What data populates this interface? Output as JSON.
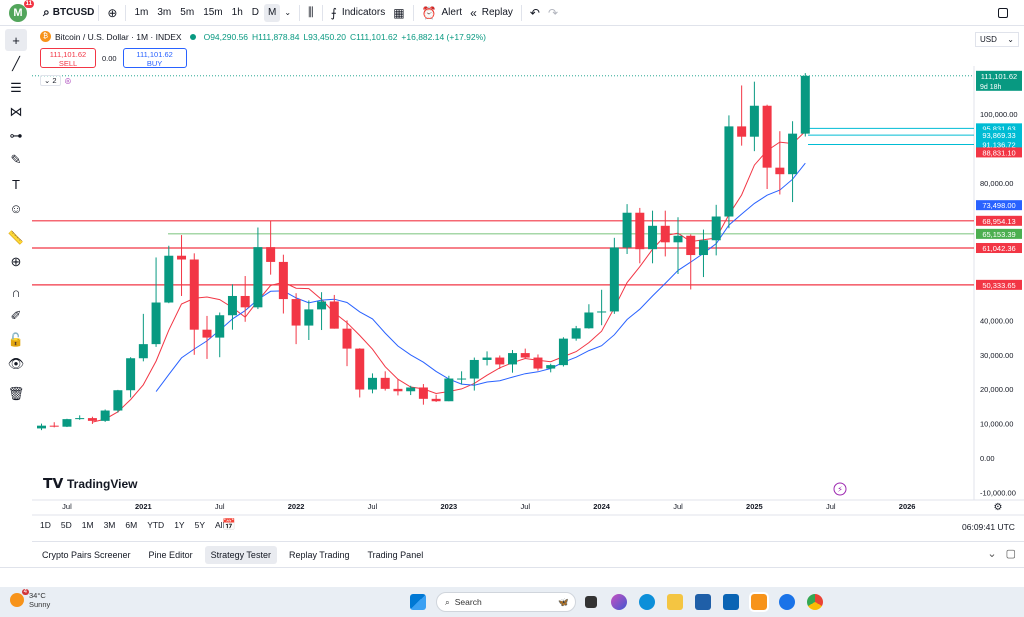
{
  "topbar": {
    "avatar_letter": "M",
    "notification_count": "11",
    "symbol": "BTCUSD",
    "timeframes": [
      "1m",
      "3m",
      "5m",
      "15m",
      "1h",
      "D",
      "M"
    ],
    "active_timeframe": "M",
    "indicators_label": "Indicators",
    "alert_label": "Alert",
    "replay_label": "Replay"
  },
  "legend": {
    "title": "Bitcoin / U.S. Dollar · 1M · INDEX",
    "open": "O94,290.56",
    "high": "H111,878.84",
    "low": "L93,450.20",
    "close": "C111,101.62",
    "change": "+16,882.14 (+17.92%)"
  },
  "trade": {
    "sell_price": "111,101.62",
    "sell_label": "SELL",
    "spread": "0.00",
    "buy_price": "111,101.62",
    "buy_label": "BUY"
  },
  "indicator_count": "2",
  "currency": "USD",
  "chart_data": {
    "type": "candlestick",
    "y_range": [
      -10000,
      125000
    ],
    "y_ticks": [
      "100,000.00",
      "80,000.00",
      "40,000.00",
      "30,000.00",
      "20,000.00",
      "10,000.00",
      "0.00",
      "-10,000.00"
    ],
    "x_ticks": [
      "Jul",
      "2021",
      "Jul",
      "2022",
      "Jul",
      "2023",
      "Jul",
      "2024",
      "Jul",
      "2025",
      "Jul",
      "2026"
    ],
    "candles": [
      {
        "date": "2020-05",
        "o": 8600,
        "h": 10000,
        "l": 8100,
        "c": 9400
      },
      {
        "date": "2020-06",
        "o": 9400,
        "h": 10400,
        "l": 8900,
        "c": 9100
      },
      {
        "date": "2020-07",
        "o": 9100,
        "h": 11400,
        "l": 9000,
        "c": 11300
      },
      {
        "date": "2020-08",
        "o": 11300,
        "h": 12400,
        "l": 11100,
        "c": 11600
      },
      {
        "date": "2020-09",
        "o": 11600,
        "h": 12000,
        "l": 9900,
        "c": 10800
      },
      {
        "date": "2020-10",
        "o": 10800,
        "h": 14100,
        "l": 10500,
        "c": 13800
      },
      {
        "date": "2020-11",
        "o": 13800,
        "h": 19800,
        "l": 13200,
        "c": 19700
      },
      {
        "date": "2020-12",
        "o": 19700,
        "h": 29300,
        "l": 17600,
        "c": 29000
      },
      {
        "date": "2021-01",
        "o": 29000,
        "h": 41900,
        "l": 28100,
        "c": 33100
      },
      {
        "date": "2021-02",
        "o": 33100,
        "h": 58300,
        "l": 32300,
        "c": 45200
      },
      {
        "date": "2021-03",
        "o": 45200,
        "h": 61700,
        "l": 45000,
        "c": 58800
      },
      {
        "date": "2021-04",
        "o": 58800,
        "h": 64800,
        "l": 47100,
        "c": 57700
      },
      {
        "date": "2021-05",
        "o": 57700,
        "h": 59500,
        "l": 30000,
        "c": 37300
      },
      {
        "date": "2021-06",
        "o": 37300,
        "h": 41300,
        "l": 28800,
        "c": 35000
      },
      {
        "date": "2021-07",
        "o": 35000,
        "h": 42300,
        "l": 29300,
        "c": 41500
      },
      {
        "date": "2021-08",
        "o": 41500,
        "h": 50500,
        "l": 37300,
        "c": 47100
      },
      {
        "date": "2021-09",
        "o": 47100,
        "h": 52900,
        "l": 39600,
        "c": 43800
      },
      {
        "date": "2021-10",
        "o": 43800,
        "h": 67000,
        "l": 43300,
        "c": 61300
      },
      {
        "date": "2021-11",
        "o": 61300,
        "h": 69000,
        "l": 53300,
        "c": 57000
      },
      {
        "date": "2021-12",
        "o": 57000,
        "h": 59100,
        "l": 42000,
        "c": 46200
      },
      {
        "date": "2022-01",
        "o": 46200,
        "h": 47900,
        "l": 33100,
        "c": 38500
      },
      {
        "date": "2022-02",
        "o": 38500,
        "h": 45800,
        "l": 34300,
        "c": 43200
      },
      {
        "date": "2022-03",
        "o": 43200,
        "h": 48200,
        "l": 37200,
        "c": 45500
      },
      {
        "date": "2022-04",
        "o": 45500,
        "h": 47400,
        "l": 37600,
        "c": 37600
      },
      {
        "date": "2022-05",
        "o": 37600,
        "h": 40000,
        "l": 26700,
        "c": 31800
      },
      {
        "date": "2022-06",
        "o": 31800,
        "h": 31900,
        "l": 17600,
        "c": 19900
      },
      {
        "date": "2022-07",
        "o": 19900,
        "h": 24600,
        "l": 18800,
        "c": 23300
      },
      {
        "date": "2022-08",
        "o": 23300,
        "h": 25200,
        "l": 19600,
        "c": 20100
      },
      {
        "date": "2022-09",
        "o": 20100,
        "h": 22800,
        "l": 18200,
        "c": 19400
      },
      {
        "date": "2022-10",
        "o": 19400,
        "h": 21000,
        "l": 18300,
        "c": 20500
      },
      {
        "date": "2022-11",
        "o": 20500,
        "h": 21500,
        "l": 15500,
        "c": 17200
      },
      {
        "date": "2022-12",
        "o": 17200,
        "h": 18400,
        "l": 16300,
        "c": 16500
      },
      {
        "date": "2023-01",
        "o": 16500,
        "h": 23900,
        "l": 16500,
        "c": 23100
      },
      {
        "date": "2023-02",
        "o": 23100,
        "h": 25200,
        "l": 21400,
        "c": 23100
      },
      {
        "date": "2023-03",
        "o": 23100,
        "h": 29200,
        "l": 19600,
        "c": 28500
      },
      {
        "date": "2023-04",
        "o": 28500,
        "h": 31000,
        "l": 26900,
        "c": 29200
      },
      {
        "date": "2023-05",
        "o": 29200,
        "h": 29800,
        "l": 25900,
        "c": 27200
      },
      {
        "date": "2023-06",
        "o": 27200,
        "h": 31400,
        "l": 24800,
        "c": 30500
      },
      {
        "date": "2023-07",
        "o": 30500,
        "h": 31800,
        "l": 28900,
        "c": 29200
      },
      {
        "date": "2023-08",
        "o": 29200,
        "h": 30100,
        "l": 25400,
        "c": 26000
      },
      {
        "date": "2023-09",
        "o": 26000,
        "h": 27400,
        "l": 24900,
        "c": 27000
      },
      {
        "date": "2023-10",
        "o": 27000,
        "h": 35100,
        "l": 26600,
        "c": 34700
      },
      {
        "date": "2023-11",
        "o": 34700,
        "h": 38400,
        "l": 34100,
        "c": 37700
      },
      {
        "date": "2023-12",
        "o": 37700,
        "h": 44700,
        "l": 37600,
        "c": 42300
      },
      {
        "date": "2024-01",
        "o": 42300,
        "h": 48900,
        "l": 38600,
        "c": 42600
      },
      {
        "date": "2024-02",
        "o": 42600,
        "h": 64000,
        "l": 41900,
        "c": 61200
      },
      {
        "date": "2024-03",
        "o": 61200,
        "h": 73800,
        "l": 59300,
        "c": 71300
      },
      {
        "date": "2024-04",
        "o": 71300,
        "h": 72700,
        "l": 56600,
        "c": 60700
      },
      {
        "date": "2024-05",
        "o": 60700,
        "h": 71900,
        "l": 56600,
        "c": 67500
      },
      {
        "date": "2024-06",
        "o": 67500,
        "h": 71900,
        "l": 58600,
        "c": 62700
      },
      {
        "date": "2024-07",
        "o": 62700,
        "h": 70000,
        "l": 53500,
        "c": 64600
      },
      {
        "date": "2024-08",
        "o": 64600,
        "h": 65000,
        "l": 49000,
        "c": 59000
      },
      {
        "date": "2024-09",
        "o": 59000,
        "h": 66400,
        "l": 52600,
        "c": 63300
      },
      {
        "date": "2024-10",
        "o": 63300,
        "h": 73600,
        "l": 58900,
        "c": 70200
      },
      {
        "date": "2024-11",
        "o": 70200,
        "h": 99600,
        "l": 66800,
        "c": 96400
      },
      {
        "date": "2024-12",
        "o": 96400,
        "h": 108300,
        "l": 90800,
        "c": 93400
      },
      {
        "date": "2025-01",
        "o": 93400,
        "h": 109400,
        "l": 89200,
        "c": 102400
      },
      {
        "date": "2025-02",
        "o": 102400,
        "h": 102700,
        "l": 78200,
        "c": 84400
      },
      {
        "date": "2025-03",
        "o": 84400,
        "h": 95000,
        "l": 76600,
        "c": 82500
      },
      {
        "date": "2025-04",
        "o": 82500,
        "h": 97900,
        "l": 74400,
        "c": 94290.56
      },
      {
        "date": "2025-05",
        "o": 94290.56,
        "h": 111878.84,
        "l": 93450.2,
        "c": 111101.62
      }
    ],
    "price_lines": [
      {
        "value": 68954.13,
        "label": "68,954.13",
        "color": "#f23645"
      },
      {
        "value": 61042.36,
        "label": "61,042.36",
        "color": "#f23645"
      },
      {
        "value": 50333.65,
        "label": "50,333.65",
        "color": "#f23645"
      },
      {
        "value": 65153.39,
        "label": "65,153.39",
        "color": "#4caf50"
      }
    ],
    "extra_labels": [
      {
        "value": 111101.62,
        "label": "111,101.62",
        "sub": "9d 18h",
        "color": "#089981"
      },
      {
        "value": 95831.63,
        "label": "95,831.63",
        "color": "#00bcd4"
      },
      {
        "value": 93869.33,
        "label": "93,869.33",
        "color": "#00bcd4"
      },
      {
        "value": 91136.72,
        "label": "91,136.72",
        "color": "#00bcd4"
      },
      {
        "value": 88831.1,
        "label": "88,831.10",
        "color": "#f23645"
      },
      {
        "value": 73498.0,
        "label": "73,498.00",
        "color": "#2962ff"
      }
    ],
    "up_color": "#089981",
    "down_color": "#f23645",
    "ma_fast_color": "#f23645",
    "ma_slow_color": "#2962ff",
    "ma_fast_period": 5,
    "ma_slow_period": 10,
    "watermark": "TradingView"
  },
  "bottom": {
    "ranges": [
      "1D",
      "5D",
      "1M",
      "3M",
      "6M",
      "YTD",
      "1Y",
      "5Y",
      "All"
    ],
    "clock": "06:09:41 UTC",
    "tabs": [
      "Crypto Pairs Screener",
      "Pine Editor",
      "Strategy Tester",
      "Replay Trading",
      "Trading Panel"
    ],
    "active_tab": "Strategy Tester"
  },
  "taskbar": {
    "temperature": "34°C",
    "weather": "Sunny",
    "weather_badge": "4",
    "search_placeholder": "Search"
  }
}
